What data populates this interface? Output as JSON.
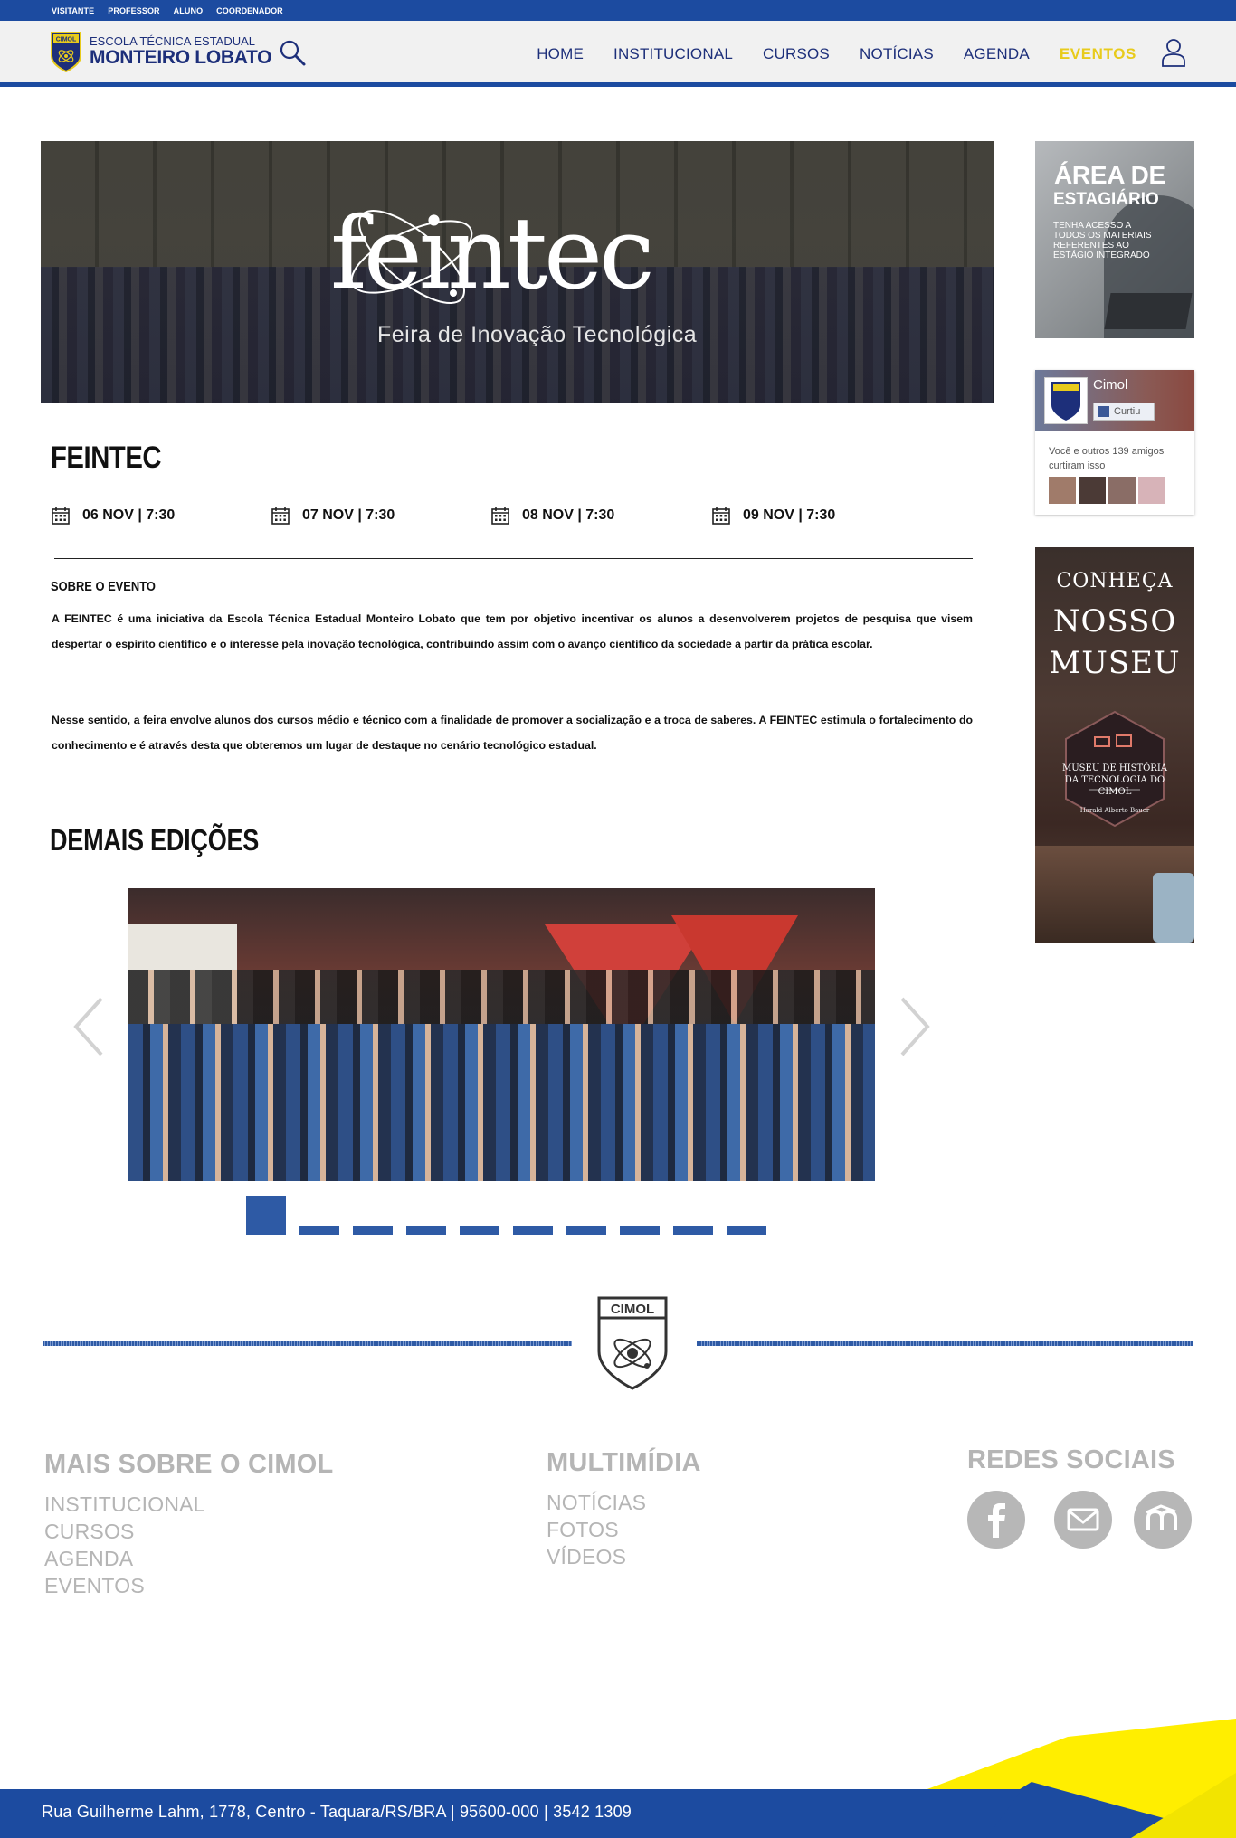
{
  "topbar": {
    "links": [
      "VISITANTE",
      "PROFESSOR",
      "ALUNO",
      "COORDENADOR"
    ]
  },
  "header": {
    "logo_badge": "CIMOL",
    "logo_line1": "ESCOLA TÉCNICA ESTADUAL",
    "logo_line2": "MONTEIRO LOBATO",
    "nav": [
      "HOME",
      "INSTITUCIONAL",
      "CURSOS",
      "NOTÍCIAS",
      "AGENDA",
      "EVENTOS"
    ],
    "active_nav": "EVENTOS",
    "accent_color": "#1c4ba0",
    "active_color": "#e8cb1c"
  },
  "hero": {
    "brand": "feintec",
    "subtitle": "Feira de Inovação Tecnológica"
  },
  "event": {
    "title": "FEINTEC",
    "dates": [
      "06 NOV | 7:30",
      "07 NOV | 7:30",
      "08 NOV | 7:30",
      "09 NOV | 7:30"
    ],
    "about_heading": "SOBRE O EVENTO",
    "paragraph1": "A FEINTEC é uma iniciativa da Escola Técnica Estadual Monteiro Lobato que tem por objetivo incentivar os alunos a desenvolverem projetos de pesquisa que visem despertar o espírito científico e o interesse pela inovação tecnológica, contribuindo assim com o avanço científico da sociedade a partir da prática escolar.",
    "paragraph2": "Nesse sentido, a feira envolve alunos dos cursos médio e técnico com a finalidade de promover a socialização e a troca de saberes. A FEINTEC estimula o fortalecimento do conhecimento e é através desta que obteremos um lugar de destaque no cenário tecnológico estadual."
  },
  "editions": {
    "heading": "DEMAIS EDIÇÕES",
    "slide_count": 10,
    "active_slide": 1
  },
  "sidebar": {
    "stage": {
      "line1": "ÁREA DE",
      "line2": "ESTAGIÁRIO",
      "line3": "TENHA ACESSO A TODOS OS MATERIAIS REFERENTES AO ESTÁGIO INTEGRADO"
    },
    "facebook": {
      "page_name": "Cimol",
      "like_label": "Curtiu",
      "friends_text": "Você e outros 139 amigos curtiram isso"
    },
    "museum": {
      "line1": "CONHEÇA",
      "line2": "NOSSO",
      "line3": "MUSEU",
      "badge": "MUSEU DE HISTÓRIA DA TECNOLOGIA DO CIMOL",
      "badge_sub": "Harald Alberto Bauer"
    }
  },
  "footer": {
    "logo_badge": "CIMOL",
    "col1": {
      "heading": "MAIS SOBRE O CIMOL",
      "links": [
        "INSTITUCIONAL",
        "CURSOS",
        "AGENDA",
        "EVENTOS"
      ]
    },
    "col2": {
      "heading": "MULTIMÍDIA",
      "links": [
        "NOTÍCIAS",
        "FOTOS",
        "VÍDEOS"
      ]
    },
    "col3": {
      "heading": "REDES SOCIAIS",
      "icons": [
        "facebook-icon",
        "mail-icon",
        "moodle-icon"
      ]
    },
    "address": "Rua Guilherme Lahm, 1778, Centro - Taquara/RS/BRA | 95600-000 | 3542 1309",
    "stripe_colors": [
      "#1c4ba0",
      "#ffee00"
    ]
  }
}
